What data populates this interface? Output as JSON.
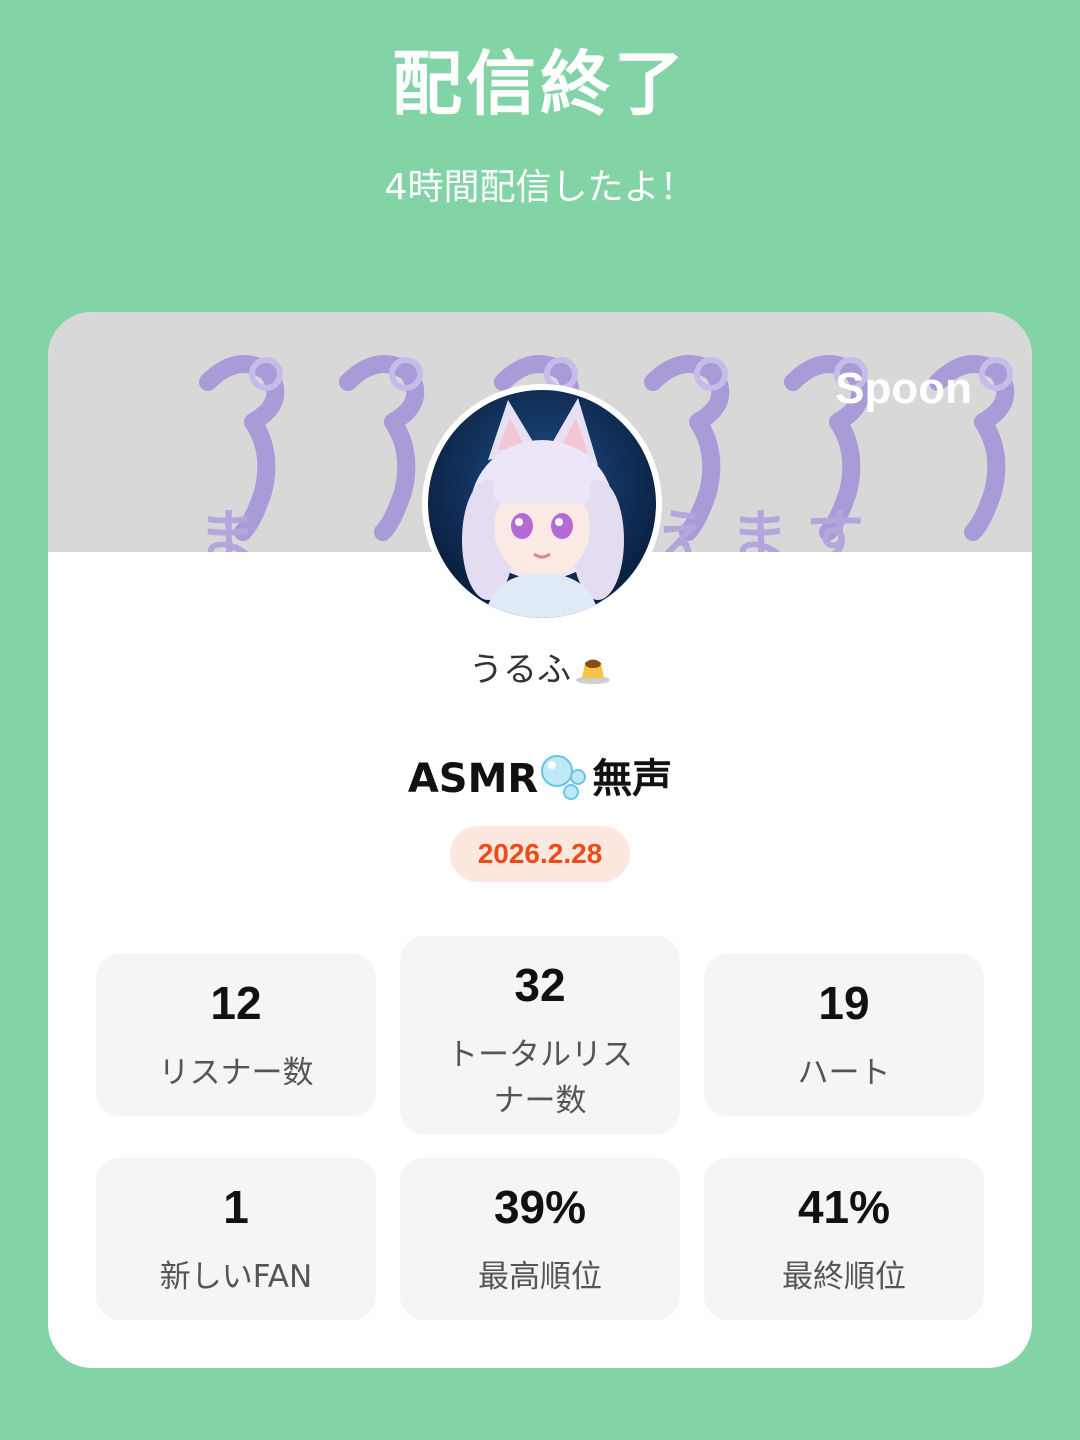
{
  "header": {
    "title": "配信終了",
    "subtitle": "4時間配信したよ！"
  },
  "banner": {
    "caption": "ま　　　　　えます",
    "brand": "Spoon"
  },
  "profile": {
    "username": "うるふ"
  },
  "live": {
    "title_prefix": "ASMR",
    "title_suffix": "無声",
    "date": "2026.2.28"
  },
  "stats": [
    {
      "value": "12",
      "label": "リスナー数"
    },
    {
      "value": "32",
      "label": "トータルリスナー数"
    },
    {
      "value": "19",
      "label": "ハート"
    },
    {
      "value": "1",
      "label": "新しいFAN"
    },
    {
      "value": "39%",
      "label": "最高順位"
    },
    {
      "value": "41%",
      "label": "最終順位"
    }
  ],
  "colors": {
    "background": "#82d4a6",
    "card": "#ffffff",
    "banner": "#d8d8d8",
    "accent": "#ee4b17",
    "badge_bg": "#fde8e0",
    "tile": "#f5f5f5"
  },
  "icons": [
    "pudding-icon",
    "bubbles-icon"
  ]
}
